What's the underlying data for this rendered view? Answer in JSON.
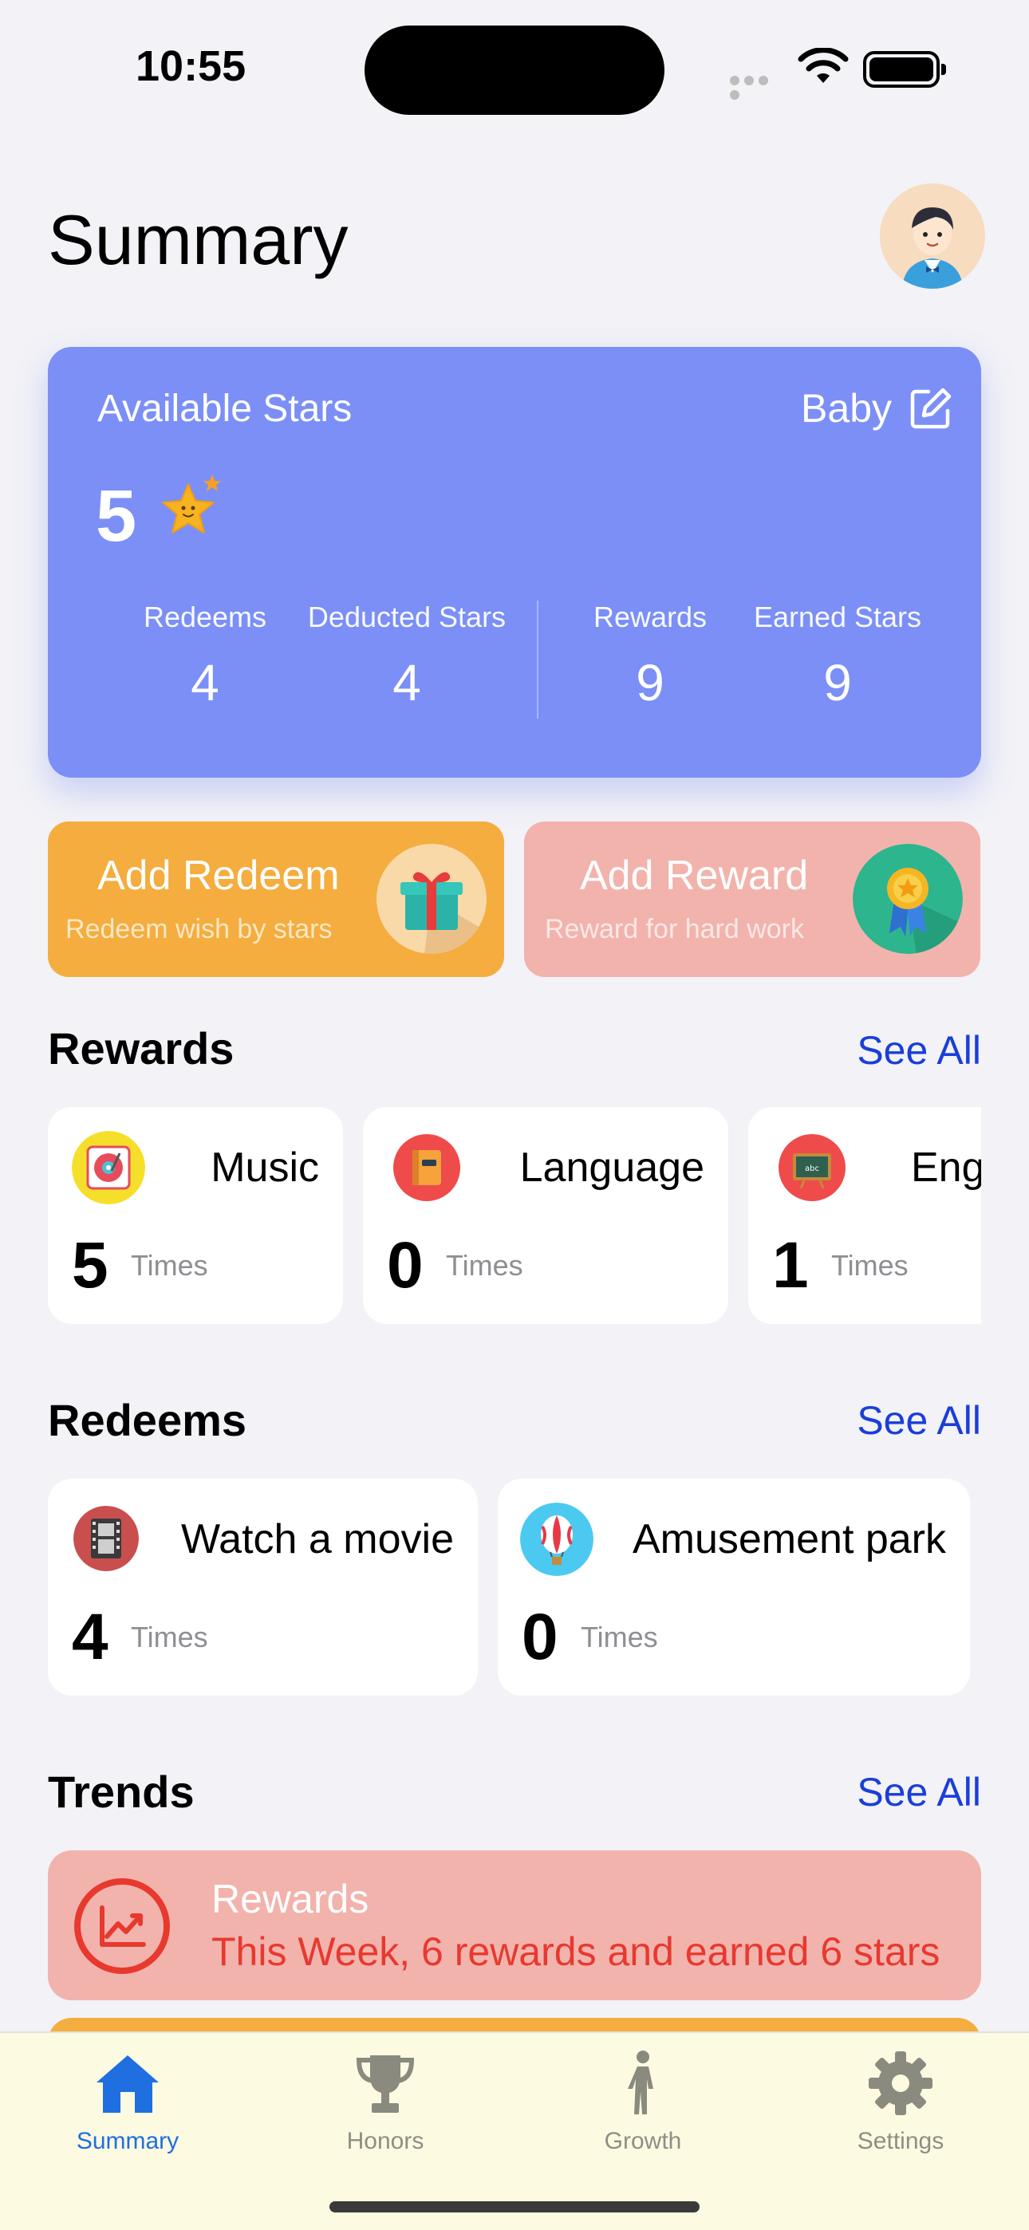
{
  "status_bar": {
    "time": "10:55"
  },
  "header": {
    "title": "Summary"
  },
  "stars_card": {
    "title": "Available Stars",
    "profile_name": "Baby",
    "available": "5",
    "stats": [
      {
        "label": "Redeems",
        "value": "4"
      },
      {
        "label": "Deducted Stars",
        "value": "4"
      },
      {
        "label": "Rewards",
        "value": "9"
      },
      {
        "label": "Earned Stars",
        "value": "9"
      }
    ]
  },
  "actions": {
    "add_redeem": {
      "title": "Add Redeem",
      "subtitle": "Redeem wish by stars"
    },
    "add_reward": {
      "title": "Add Reward",
      "subtitle": "Reward for hard work"
    }
  },
  "rewards": {
    "title": "Rewards",
    "see_all": "See All",
    "items": [
      {
        "name": "Music",
        "count": "5",
        "unit": "Times",
        "icon": "music-icon"
      },
      {
        "name": "Language",
        "count": "0",
        "unit": "Times",
        "icon": "book-icon"
      },
      {
        "name": "Eng",
        "count": "1",
        "unit": "Times",
        "icon": "chalkboard-icon"
      }
    ]
  },
  "redeems": {
    "title": "Redeems",
    "see_all": "See All",
    "items": [
      {
        "name": "Watch a movie",
        "count": "4",
        "unit": "Times",
        "icon": "film-icon"
      },
      {
        "name": "Amusement park",
        "count": "0",
        "unit": "Times",
        "icon": "hot-air-balloon-icon"
      }
    ]
  },
  "trends": {
    "title": "Trends",
    "see_all": "See All",
    "items": [
      {
        "title": "Rewards",
        "subtitle": "This Week, 6 rewards and earned 6 stars"
      }
    ]
  },
  "tab_bar": {
    "tabs": [
      {
        "label": "Summary",
        "icon": "home-icon",
        "active": true
      },
      {
        "label": "Honors",
        "icon": "trophy-icon",
        "active": false
      },
      {
        "label": "Growth",
        "icon": "person-icon",
        "active": false
      },
      {
        "label": "Settings",
        "icon": "gear-icon",
        "active": false
      }
    ]
  },
  "colors": {
    "accent_blue": "#1f6fe0",
    "stars_card": "#7b8ff6",
    "redeem_orange": "#f4ad3e",
    "reward_pink": "#f2b3ad",
    "trend_red": "#e8392f",
    "link_blue": "#1a3ed8"
  }
}
